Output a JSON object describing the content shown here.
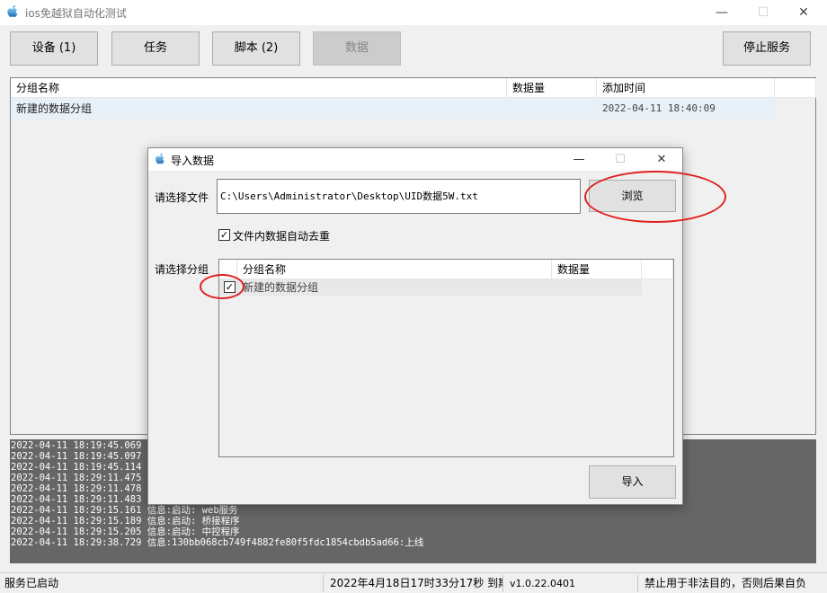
{
  "window": {
    "title": "ios免越狱自动化测试",
    "minimize": "—",
    "maximize": "☐",
    "close": "✕"
  },
  "toolbar": {
    "devices": "设备 (1)",
    "tasks": "任务",
    "scripts": "脚本 (2)",
    "data": "数据",
    "stop_service": "停止服务"
  },
  "main_grid": {
    "columns": [
      "分组名称",
      "数据量",
      "添加时间"
    ],
    "rows": [
      {
        "name": "新建的数据分组",
        "count": "",
        "time": "2022-04-11 18:40:09"
      }
    ]
  },
  "log": [
    "2022-04-11 18:19:45.069 信",
    "2022-04-11 18:19:45.097 信",
    "2022-04-11 18:19:45.114 信",
    "2022-04-11 18:29:11.475 信",
    "2022-04-11 18:29:11.478 信",
    "2022-04-11 18:29:11.483 信",
    "2022-04-11 18:29:15.161 信息:启动: web服务",
    "2022-04-11 18:29:15.189 信息:启动: 桥接程序",
    "2022-04-11 18:29:15.205 信息:启动: 中控程序",
    "2022-04-11 18:29:38.729 信息:130bb068cb749f4882fe80f5fdc1854cbdb5ad66:上线"
  ],
  "status": {
    "service": "服务已启动",
    "expiry": "2022年4月18日17时33分17秒 到期",
    "version": "v1.0.22.0401",
    "warning": "禁止用于非法目的，否则后果自负"
  },
  "dialog": {
    "title": "导入数据",
    "minimize": "—",
    "maximize": "☐",
    "close": "✕",
    "file_label": "请选择文件",
    "file_path": "C:\\Users\\Administrator\\Desktop\\UID数据5W.txt",
    "browse": "浏览",
    "dedupe_check": "✓",
    "dedupe_label": "文件内数据自动去重",
    "group_label": "请选择分组",
    "group_columns": [
      "分组名称",
      "数据量"
    ],
    "groups": [
      {
        "check": "✓",
        "name": "新建的数据分组"
      }
    ],
    "import": "导入"
  },
  "colors": {
    "highlight_circle": "#e02020",
    "log_background": "#666666"
  }
}
